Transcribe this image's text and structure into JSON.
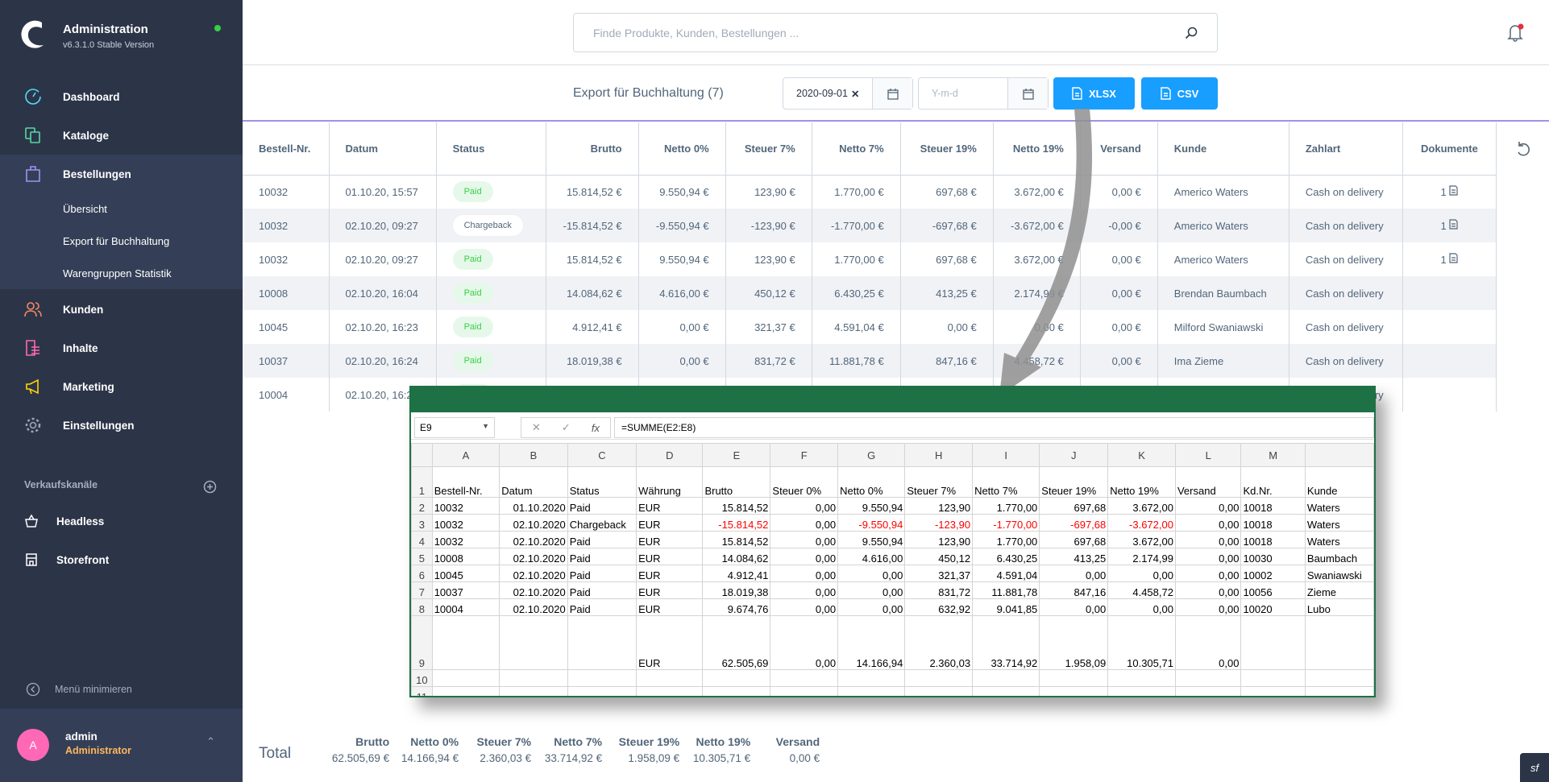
{
  "app": {
    "title": "Administration",
    "version": "v6.3.1.0 Stable Version",
    "online_color": "#37d046"
  },
  "sidebar": {
    "items": [
      {
        "label": "Dashboard",
        "icon": "gauge-icon",
        "color": "#57d9f7"
      },
      {
        "label": "Kataloge",
        "icon": "catalog-icon",
        "color": "#57d9a3"
      },
      {
        "label": "Bestellungen",
        "icon": "shopping-bag-icon",
        "color": "#a092f0"
      },
      {
        "label": "Kunden",
        "icon": "users-icon",
        "color": "#f88962"
      },
      {
        "label": "Inhalte",
        "icon": "content-icon",
        "color": "#ff68b4"
      },
      {
        "label": "Marketing",
        "icon": "megaphone-icon",
        "color": "#ffd700"
      },
      {
        "label": "Einstellungen",
        "icon": "gear-icon",
        "color": "#9aa8b5"
      }
    ],
    "orders_sub": [
      "Übersicht",
      "Export für Buchhaltung",
      "Warengruppen Statistik"
    ],
    "sales_channels_label": "Verkaufskanäle",
    "channels": [
      {
        "label": "Headless",
        "icon": "basket-icon"
      },
      {
        "label": "Storefront",
        "icon": "storefront-icon"
      }
    ],
    "minimize_label": "Menü minimieren",
    "user": {
      "initial": "A",
      "name": "admin",
      "role": "Administrator",
      "role_color": "#ffb75d"
    }
  },
  "search": {
    "placeholder": "Finde Produkte, Kunden, Bestellungen ..."
  },
  "toolbar": {
    "title": "Export für Buchhaltung",
    "count": "(7)",
    "date_from": "2020-09-01",
    "date_to_placeholder": "Y-m-d",
    "xlsx_label": "XLSX",
    "csv_label": "CSV",
    "accent": "#189eff"
  },
  "table": {
    "headers": [
      "Bestell-Nr.",
      "Datum",
      "Status",
      "Brutto",
      "Netto 0%",
      "Steuer 7%",
      "Netto 7%",
      "Steuer 19%",
      "Netto 19%",
      "Versand",
      "Kunde",
      "Zahlart",
      "Dokumente"
    ],
    "rows": [
      [
        "10032",
        "01.10.20, 15:57",
        "Paid",
        "15.814,52 €",
        "9.550,94 €",
        "123,90 €",
        "1.770,00 €",
        "697,68 €",
        "3.672,00 €",
        "0,00 €",
        "Americo Waters",
        "Cash on delivery",
        "1"
      ],
      [
        "10032",
        "02.10.20, 09:27",
        "Chargeback",
        "-15.814,52 €",
        "-9.550,94 €",
        "-123,90 €",
        "-1.770,00 €",
        "-697,68 €",
        "-3.672,00 €",
        "-0,00 €",
        "Americo Waters",
        "Cash on delivery",
        "1"
      ],
      [
        "10032",
        "02.10.20, 09:27",
        "Paid",
        "15.814,52 €",
        "9.550,94 €",
        "123,90 €",
        "1.770,00 €",
        "697,68 €",
        "3.672,00 €",
        "0,00 €",
        "Americo Waters",
        "Cash on delivery",
        "1"
      ],
      [
        "10008",
        "02.10.20, 16:04",
        "Paid",
        "14.084,62 €",
        "4.616,00 €",
        "450,12 €",
        "6.430,25 €",
        "413,25 €",
        "2.174,99 €",
        "0,00 €",
        "Brendan Baumbach",
        "Cash on delivery",
        ""
      ],
      [
        "10045",
        "02.10.20, 16:23",
        "Paid",
        "4.912,41 €",
        "0,00 €",
        "321,37 €",
        "4.591,04 €",
        "0,00 €",
        "0,00 €",
        "0,00 €",
        "Milford Swaniawski",
        "Cash on delivery",
        ""
      ],
      [
        "10037",
        "02.10.20, 16:24",
        "Paid",
        "18.019,38 €",
        "0,00 €",
        "831,72 €",
        "11.881,78 €",
        "847,16 €",
        "4.458,72 €",
        "0,00 €",
        "Ima Zieme",
        "Cash on delivery",
        ""
      ],
      [
        "10004",
        "02.10.20, 16:2",
        "Paid",
        "",
        "",
        "",
        "",
        "",
        "",
        "",
        "",
        "Cash on delivery",
        ""
      ]
    ]
  },
  "excel": {
    "name_box": "E9",
    "formula": "=SUMME(E2:E8)",
    "title_color": "#1e7145",
    "columns": [
      "A",
      "B",
      "C",
      "D",
      "E",
      "F",
      "G",
      "H",
      "I",
      "J",
      "K",
      "L",
      "M",
      ""
    ],
    "row_numbers": [
      "1",
      "2",
      "3",
      "4",
      "5",
      "6",
      "7",
      "8",
      "9",
      "10",
      "11"
    ],
    "header_row": [
      "Bestell-Nr.",
      "Datum",
      "Status",
      "Währung",
      "Brutto",
      "Steuer 0%",
      "Netto 0%",
      "Steuer 7%",
      "Netto 7%",
      "Steuer 19%",
      "Netto 19%",
      "Versand",
      "Kd.Nr.",
      "Kunde"
    ],
    "rows": [
      [
        "10032",
        "01.10.2020",
        "Paid",
        "EUR",
        "15.814,52",
        "0,00",
        "9.550,94",
        "123,90",
        "1.770,00",
        "697,68",
        "3.672,00",
        "0,00",
        "10018",
        "Waters"
      ],
      [
        "10032",
        "02.10.2020",
        "Chargeback",
        "EUR",
        "-15.814,52",
        "0,00",
        "-9.550,94",
        "-123,90",
        "-1.770,00",
        "-697,68",
        "-3.672,00",
        "0,00",
        "10018",
        "Waters"
      ],
      [
        "10032",
        "02.10.2020",
        "Paid",
        "EUR",
        "15.814,52",
        "0,00",
        "9.550,94",
        "123,90",
        "1.770,00",
        "697,68",
        "3.672,00",
        "0,00",
        "10018",
        "Waters"
      ],
      [
        "10008",
        "02.10.2020",
        "Paid",
        "EUR",
        "14.084,62",
        "0,00",
        "4.616,00",
        "450,12",
        "6.430,25",
        "413,25",
        "2.174,99",
        "0,00",
        "10030",
        "Baumbach"
      ],
      [
        "10045",
        "02.10.2020",
        "Paid",
        "EUR",
        "4.912,41",
        "0,00",
        "0,00",
        "321,37",
        "4.591,04",
        "0,00",
        "0,00",
        "0,00",
        "10002",
        "Swaniawski"
      ],
      [
        "10037",
        "02.10.2020",
        "Paid",
        "EUR",
        "18.019,38",
        "0,00",
        "0,00",
        "831,72",
        "11.881,78",
        "847,16",
        "4.458,72",
        "0,00",
        "10056",
        "Zieme"
      ],
      [
        "10004",
        "02.10.2020",
        "Paid",
        "EUR",
        "9.674,76",
        "0,00",
        "0,00",
        "632,92",
        "9.041,85",
        "0,00",
        "0,00",
        "0,00",
        "10020",
        "Lubo"
      ]
    ],
    "sum_row": [
      "",
      "",
      "",
      "EUR",
      "62.505,69",
      "0,00",
      "14.166,94",
      "2.360,03",
      "33.714,92",
      "1.958,09",
      "10.305,71",
      "0,00",
      "",
      ""
    ]
  },
  "totals": {
    "label": "Total",
    "items": [
      {
        "label": "Brutto",
        "value": "62.505,69 €"
      },
      {
        "label": "Netto 0%",
        "value": "14.166,94 €"
      },
      {
        "label": "Steuer 7%",
        "value": "2.360,03 €"
      },
      {
        "label": "Netto 7%",
        "value": "33.714,92 €"
      },
      {
        "label": "Steuer 19%",
        "value": "1.958,09 €"
      },
      {
        "label": "Netto 19%",
        "value": "10.305,71 €"
      },
      {
        "label": "Versand",
        "value": "0,00 €"
      }
    ]
  }
}
